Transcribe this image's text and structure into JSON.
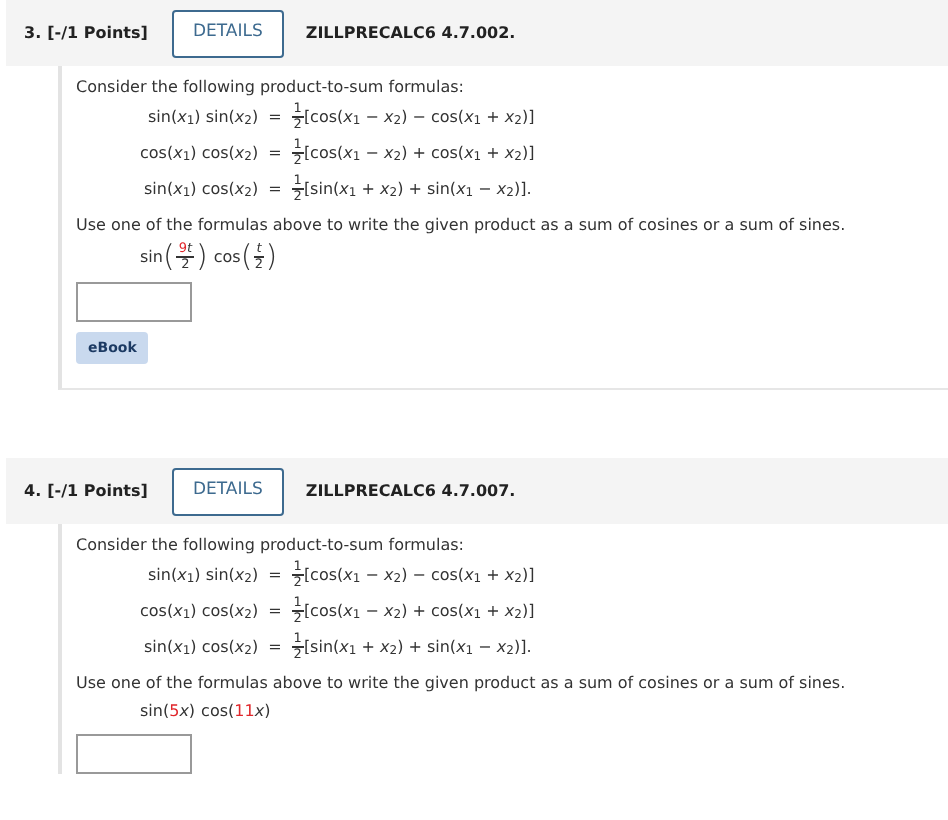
{
  "questions": [
    {
      "number": "3.",
      "points": "[-/1 Points]",
      "details_button": "DETAILS",
      "code": "ZILLPRECALC6 4.7.002.",
      "intro": "Consider the following product-to-sum formulas:",
      "formulas": [
        {
          "lhs": "sin(*x*$_{1}$) sin(*x*$_{2}$)",
          "equals": "=",
          "numerator": "1",
          "denominator": "2",
          "rhs": "[cos(*x*$_{1}$ − *x*$_{2}$) − cos(*x*$_{1}$ + *x*$_{2}$)]"
        },
        {
          "lhs": "cos(*x*$_{1}$) cos(*x*$_{2}$)",
          "equals": "=",
          "numerator": "1",
          "denominator": "2",
          "rhs": "[cos(*x*$_{1}$ − *x*$_{2}$) + cos(*x*$_{1}$ + *x*$_{2}$)]"
        },
        {
          "lhs": "sin(*x*$_{1}$) cos(*x*$_{2}$)",
          "equals": "=",
          "numerator": "1",
          "denominator": "2",
          "rhs": "[sin(*x*$_{1}$ + *x*$_{2}$) + sin(*x*$_{1}$ − *x*$_{2}$)]."
        }
      ],
      "instruction": "Use one of the formulas above to write the given product as a sum of cosines or a sum of sines.",
      "product": [
        {
          "func": "sin",
          "kind": "fraction",
          "open_paren": "(",
          "coefficient": "9",
          "variable": "t",
          "denominator": "2",
          "close_paren": ")"
        },
        {
          "func": "cos",
          "kind": "fraction",
          "open_paren": "(",
          "variable": "t",
          "denominator": "2",
          "close_paren": ")"
        }
      ],
      "ebook_button": "eBook"
    },
    {
      "number": "4.",
      "points": "[-/1 Points]",
      "details_button": "DETAILS",
      "code": "ZILLPRECALC6 4.7.007.",
      "intro": "Consider the following product-to-sum formulas:",
      "formulas": [
        {
          "lhs": "sin(*x*$_{1}$) sin(*x*$_{2}$)",
          "equals": "=",
          "numerator": "1",
          "denominator": "2",
          "rhs": "[cos(*x*$_{1}$ − *x*$_{2}$) − cos(*x*$_{1}$ + *x*$_{2}$)]"
        },
        {
          "lhs": "cos(*x*$_{1}$) cos(*x*$_{2}$)",
          "equals": "=",
          "numerator": "1",
          "denominator": "2",
          "rhs": "[cos(*x*$_{1}$ − *x*$_{2}$) + cos(*x*$_{1}$ + *x*$_{2}$)]"
        },
        {
          "lhs": "sin(*x*$_{1}$) cos(*x*$_{2}$)",
          "equals": "=",
          "numerator": "1",
          "denominator": "2",
          "rhs": "[sin(*x*$_{1}$ + *x*$_{2}$) + sin(*x*$_{1}$ − *x*$_{2}$)]."
        }
      ],
      "instruction": "Use one of the formulas above to write the given product as a sum of cosines or a sum of sines.",
      "product": [
        {
          "func": "sin",
          "kind": "linear",
          "open_paren": "(",
          "coefficient": "5",
          "variable": "x",
          "close_paren": ")"
        },
        {
          "func": "cos",
          "kind": "linear",
          "open_paren": "(",
          "coefficient": "11",
          "variable": "x",
          "close_paren": ")"
        }
      ]
    }
  ]
}
